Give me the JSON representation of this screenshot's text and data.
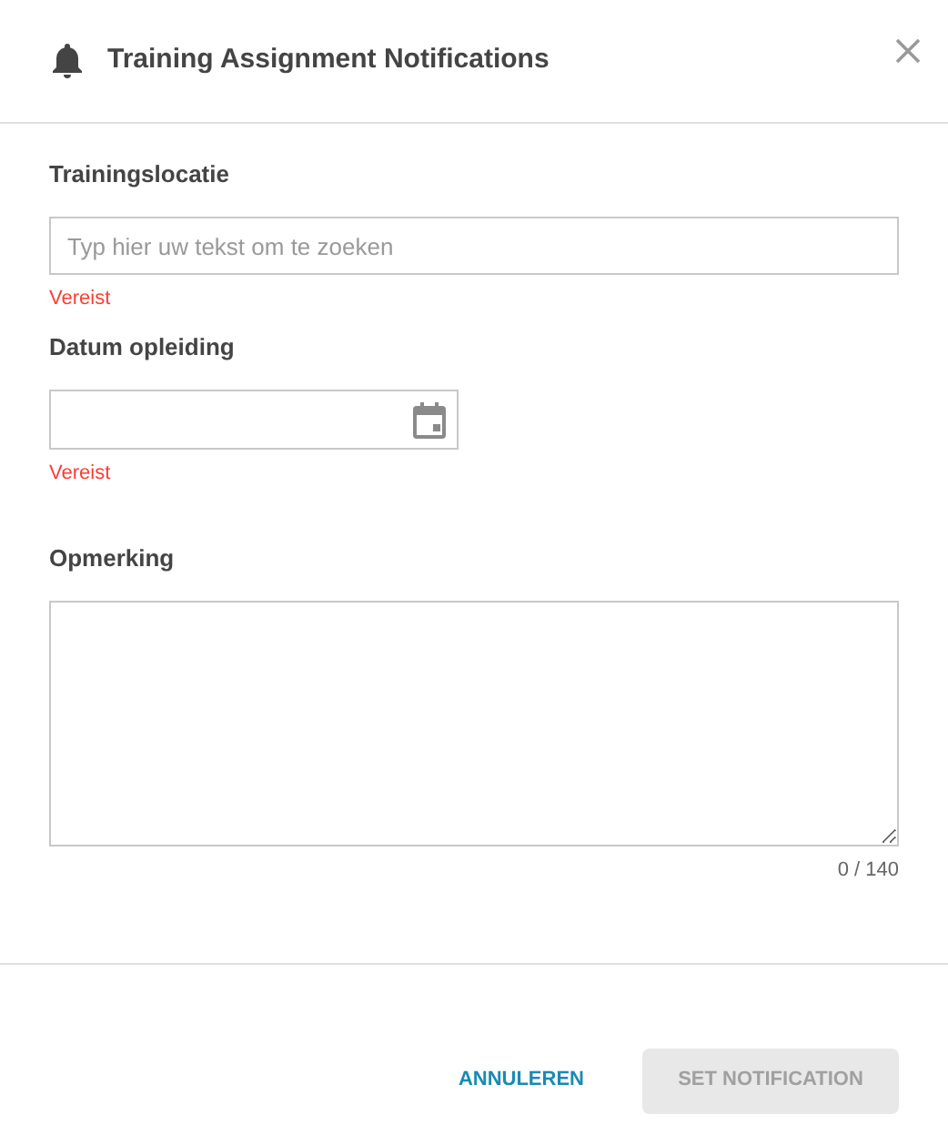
{
  "dialog": {
    "title": "Training Assignment Notifications"
  },
  "fields": [
    {
      "kind": "text",
      "label": "Trainingslocatie",
      "placeholder": "Typ hier uw tekst om te zoeken",
      "error": "Vereist"
    },
    {
      "kind": "date",
      "label": "Datum opleiding",
      "error": "Vereist"
    },
    {
      "kind": "textarea",
      "label": "Opmerking",
      "counter": "0 / 140"
    }
  ],
  "buttons": [
    {
      "label": "ANNULEREN",
      "disabled": false
    },
    {
      "label": "SET NOTIFICATION",
      "disabled": true
    }
  ]
}
